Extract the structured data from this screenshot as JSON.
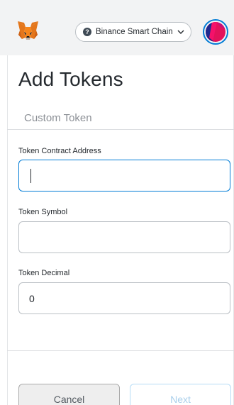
{
  "header": {
    "network_label": "Binance Smart Chain",
    "network_icon": "question-circle-icon",
    "chevron_icon": "chevron-down-icon",
    "logo_icon": "metamask-fox-icon"
  },
  "main": {
    "title": "Add Tokens",
    "tabs": [
      {
        "label": "Custom Token"
      }
    ]
  },
  "form": {
    "contract_address": {
      "label": "Token Contract Address",
      "value": ""
    },
    "symbol": {
      "label": "Token Symbol",
      "value": ""
    },
    "decimal": {
      "label": "Token Decimal",
      "value": "0"
    }
  },
  "footer": {
    "cancel_label": "Cancel",
    "next_label": "Next"
  },
  "colors": {
    "accent": "#037dd6",
    "header_bg": "#f2f3f4",
    "text": "#24292e",
    "muted": "#8c9096"
  }
}
